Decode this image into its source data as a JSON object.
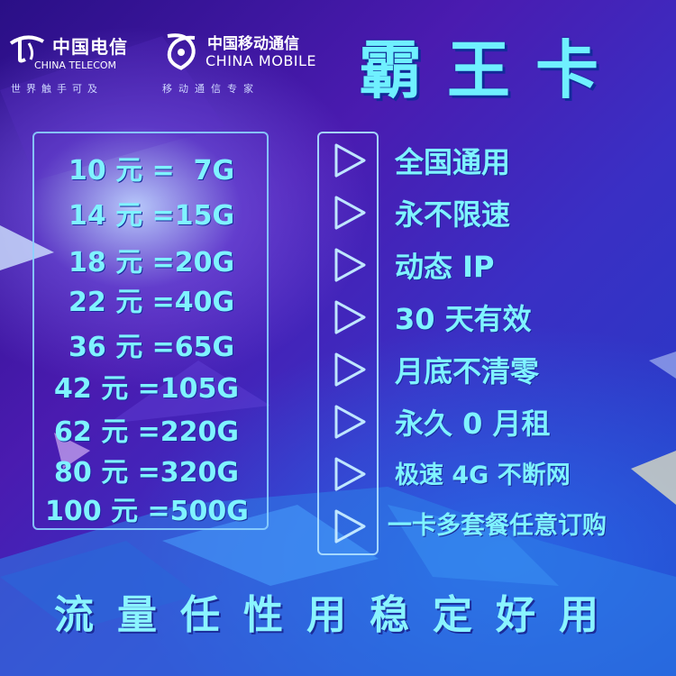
{
  "logos": {
    "telecom": {
      "name_cn": "中国电信",
      "name_en": "CHINA TELECOM",
      "slogan": "世界触手可及"
    },
    "mobile": {
      "name_cn": "中国移动通信",
      "name_en": "CHINA MOBILE",
      "slogan": "移动通信专家"
    }
  },
  "title": "霸王卡",
  "plans": [
    {
      "price": "10 元 =",
      "data": "7G"
    },
    {
      "price": "14 元 =",
      "data": "15G"
    },
    {
      "price": "18 元 =",
      "data": "20G"
    },
    {
      "price": "22 元 =",
      "data": "40G"
    },
    {
      "price": "36 元 =",
      "data": "65G"
    },
    {
      "price": "42 元 =",
      "data": "105G"
    },
    {
      "price": "62 元 =",
      "data": "220G"
    },
    {
      "price": "80 元 =",
      "data": "320G"
    },
    {
      "price": "100 元 =",
      "data": "500G"
    }
  ],
  "features": [
    "全国通用",
    "永不限速",
    "动态 IP",
    "30 天有效",
    "月底不清零",
    "永久 0 月租",
    "极速 4G 不断网",
    "一卡多套餐任意订购"
  ],
  "bottom_slogan": "流量任性用稳定好用",
  "colors": {
    "accent": "#7ff3ff",
    "background": "#3a1fae"
  },
  "icons": {
    "arrow": "play-triangle-outline-icon"
  }
}
